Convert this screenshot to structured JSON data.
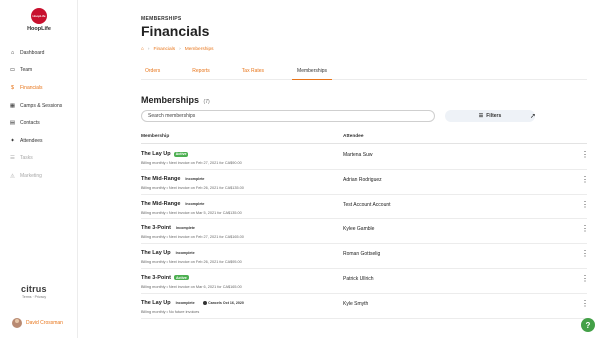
{
  "org": {
    "logo_text": "HoopLife",
    "name": "HoopLife"
  },
  "sidebar": {
    "items": [
      {
        "label": "Dashboard",
        "icon": "home-icon",
        "glyph": "⌂"
      },
      {
        "label": "Team",
        "icon": "team-icon",
        "glyph": "▭"
      },
      {
        "label": "Financials",
        "icon": "financials-icon",
        "glyph": "$"
      },
      {
        "label": "Camps & Sessions",
        "icon": "calendar-icon",
        "glyph": "▦"
      },
      {
        "label": "Contacts",
        "icon": "contacts-icon",
        "glyph": "▤"
      },
      {
        "label": "Attendees",
        "icon": "attendees-icon",
        "glyph": "✦"
      },
      {
        "label": "Tasks",
        "icon": "tasks-icon",
        "glyph": "☰"
      },
      {
        "label": "Marketing",
        "icon": "megaphone-icon",
        "glyph": "◬"
      }
    ],
    "brand": "citrus",
    "brand_links": "Terms · Privacy",
    "user_name": "David Crossman"
  },
  "header": {
    "eyebrow": "MEMBERSHIPS",
    "title": "Financials",
    "breadcrumb": [
      "Financials",
      "Memberships"
    ]
  },
  "tabs": [
    "Orders",
    "Reports",
    "Tax Rates",
    "Memberships"
  ],
  "section": {
    "title": "Memberships",
    "count": "(7)"
  },
  "search": {
    "placeholder": "Search memberships"
  },
  "filters_label": "Filters",
  "table": {
    "col_membership": "Membership",
    "col_attendee": "Attendee",
    "rows": [
      {
        "name": "The Lay Up",
        "status": "Active",
        "note": "",
        "meta": "Billing monthly • Next invoice on Feb 27, 2021 for CA$90.00",
        "attendee": "Martena Suw"
      },
      {
        "name": "The Mid-Range",
        "status": "Incomplete",
        "note": "",
        "meta": "Billing monthly • Next invoice on Feb 26, 2021 for CA$135.00",
        "attendee": "Adrian Rodriguez"
      },
      {
        "name": "The Mid-Range",
        "status": "Incomplete",
        "note": "",
        "meta": "Billing monthly • Next invoice on Mar 5, 2021 for CA$135.00",
        "attendee": "Test Account Account"
      },
      {
        "name": "The 3-Point",
        "status": "Incomplete",
        "note": "",
        "meta": "Billing monthly • Next invoice on Feb 27, 2021 for CA$165.00",
        "attendee": "Kylee Gamble"
      },
      {
        "name": "The Lay Up",
        "status": "Incomplete",
        "note": "",
        "meta": "Billing monthly • Next invoice on Feb 26, 2021 for CA$95.00",
        "attendee": "Roman Gottselig"
      },
      {
        "name": "The 3-Point",
        "status": "Active",
        "note": "",
        "meta": "Billing monthly • Next invoice on Mar 6, 2021 for CA$165.00",
        "attendee": "Patrick Ullrich"
      },
      {
        "name": "The Lay Up",
        "status": "Incomplete",
        "note": "Cancels Oct 16, 2020",
        "meta": "Billing monthly • No future invoices",
        "attendee": "Kyle Smyth"
      }
    ]
  },
  "help_label": "?",
  "colors": {
    "accent": "#e8751a",
    "active_badge": "#4caf50",
    "help": "#43a047",
    "logo": "#c8102e"
  }
}
